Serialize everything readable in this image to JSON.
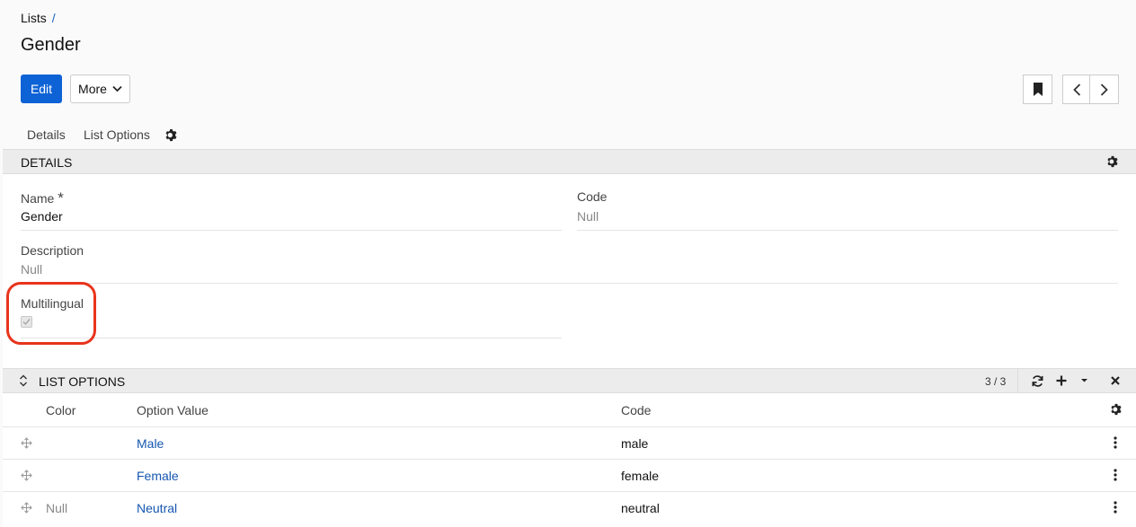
{
  "breadcrumb": {
    "root": "Lists",
    "separator": "/"
  },
  "page_title": "Gender",
  "toolbar": {
    "edit_label": "Edit",
    "more_label": "More"
  },
  "tabs": [
    {
      "label": "Details"
    },
    {
      "label": "List Options"
    }
  ],
  "details_panel": {
    "title": "DETAILS",
    "fields": {
      "name": {
        "label": "Name",
        "required_mark": "*",
        "value": "Gender"
      },
      "code": {
        "label": "Code",
        "value": "Null"
      },
      "description": {
        "label": "Description",
        "value": "Null"
      },
      "multilingual": {
        "label": "Multilingual",
        "checked": true
      }
    }
  },
  "list_options_panel": {
    "title": "LIST OPTIONS",
    "count": "3 / 3",
    "columns": {
      "color": "Color",
      "option_value": "Option Value",
      "code": "Code"
    },
    "rows": [
      {
        "color": "",
        "option_value": "Male",
        "code": "male"
      },
      {
        "color": "",
        "option_value": "Female",
        "code": "female"
      },
      {
        "color": "Null",
        "option_value": "Neutral",
        "code": "neutral"
      }
    ]
  },
  "colors": {
    "primary": "#0d62d6",
    "link": "#1557b0",
    "highlight": "#e8341c"
  }
}
